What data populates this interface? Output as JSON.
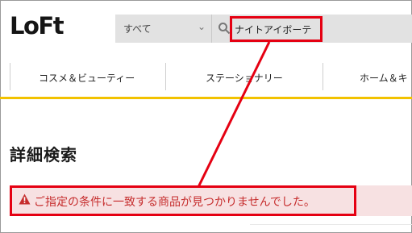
{
  "header": {
    "logo_text": "LoFt",
    "search": {
      "category": "すべて",
      "query": "ナイトアイボーテ"
    }
  },
  "nav": {
    "items": [
      {
        "label": "コスメ＆ビューティー"
      },
      {
        "label": "ステーショナリー"
      },
      {
        "label": "ホーム＆キ"
      }
    ]
  },
  "main": {
    "title": "詳細検索",
    "alert_text": "ご指定の条件に一致する商品が見つかりませんでした。"
  },
  "colors": {
    "highlight": "#e50012",
    "accent_line": "#f2c200",
    "alert_bg": "#f7e1e2",
    "alert_text": "#c62d2d"
  }
}
